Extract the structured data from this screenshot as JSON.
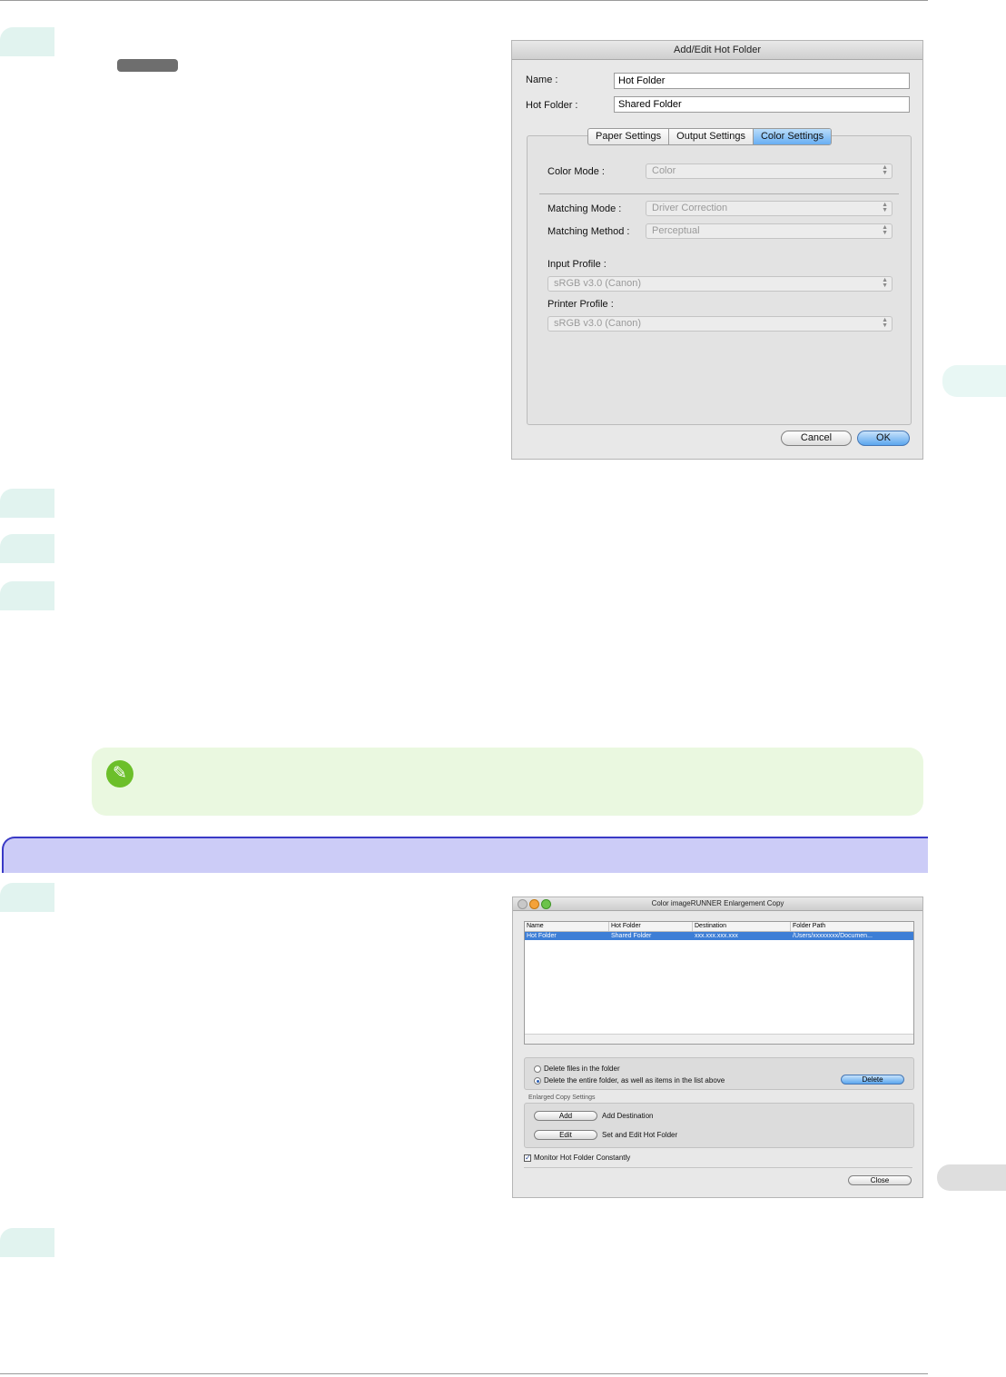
{
  "dialog1": {
    "title": "Add/Edit Hot Folder",
    "name_label": "Name :",
    "name_value": "Hot Folder",
    "hotfolder_label": "Hot Folder :",
    "hotfolder_value": "Shared Folder",
    "tabs": [
      "Paper Settings",
      "Output Settings",
      "Color Settings"
    ],
    "color_mode_label": "Color Mode :",
    "color_mode_value": "Color",
    "matching_mode_label": "Matching Mode :",
    "matching_mode_value": "Driver Correction",
    "matching_method_label": "Matching Method :",
    "matching_method_value": "Perceptual",
    "input_profile_label": "Input Profile :",
    "input_profile_value": "sRGB v3.0 (Canon)",
    "printer_profile_label": "Printer Profile :",
    "printer_profile_value": "sRGB v3.0 (Canon)",
    "cancel": "Cancel",
    "ok": "OK"
  },
  "dialog2": {
    "title": "Color imageRUNNER Enlargement Copy",
    "columns": [
      "Name",
      "Hot Folder",
      "Destination",
      "Folder Path"
    ],
    "row": [
      "Hot Folder",
      "Shared Folder",
      "xxx.xxx.xxx.xxx",
      "/Users/xxxxxxxx/Documen..."
    ],
    "radio1": "Delete files in the folder",
    "radio2": "Delete the entire folder, as well as items in the list above",
    "delete": "Delete",
    "group_label": "Enlarged Copy Settings",
    "add": "Add",
    "add_desc": "Add Destination",
    "edit": "Edit",
    "edit_desc": "Set and Edit Hot Folder",
    "monitor": "Monitor Hot Folder Constantly",
    "close": "Close"
  },
  "colors": {
    "step_tab": "#e1f3ef",
    "note_bg": "#eaf8e0",
    "section_bg": "#ccccf7",
    "section_border": "#3a3ac6",
    "selection_blue": "#3d7ed6"
  },
  "icons": [
    "pencil-note-icon",
    "window-close-light-icon",
    "window-minimize-light-icon",
    "window-zoom-light-icon",
    "popup-arrows-icon",
    "checkmark-icon"
  ]
}
